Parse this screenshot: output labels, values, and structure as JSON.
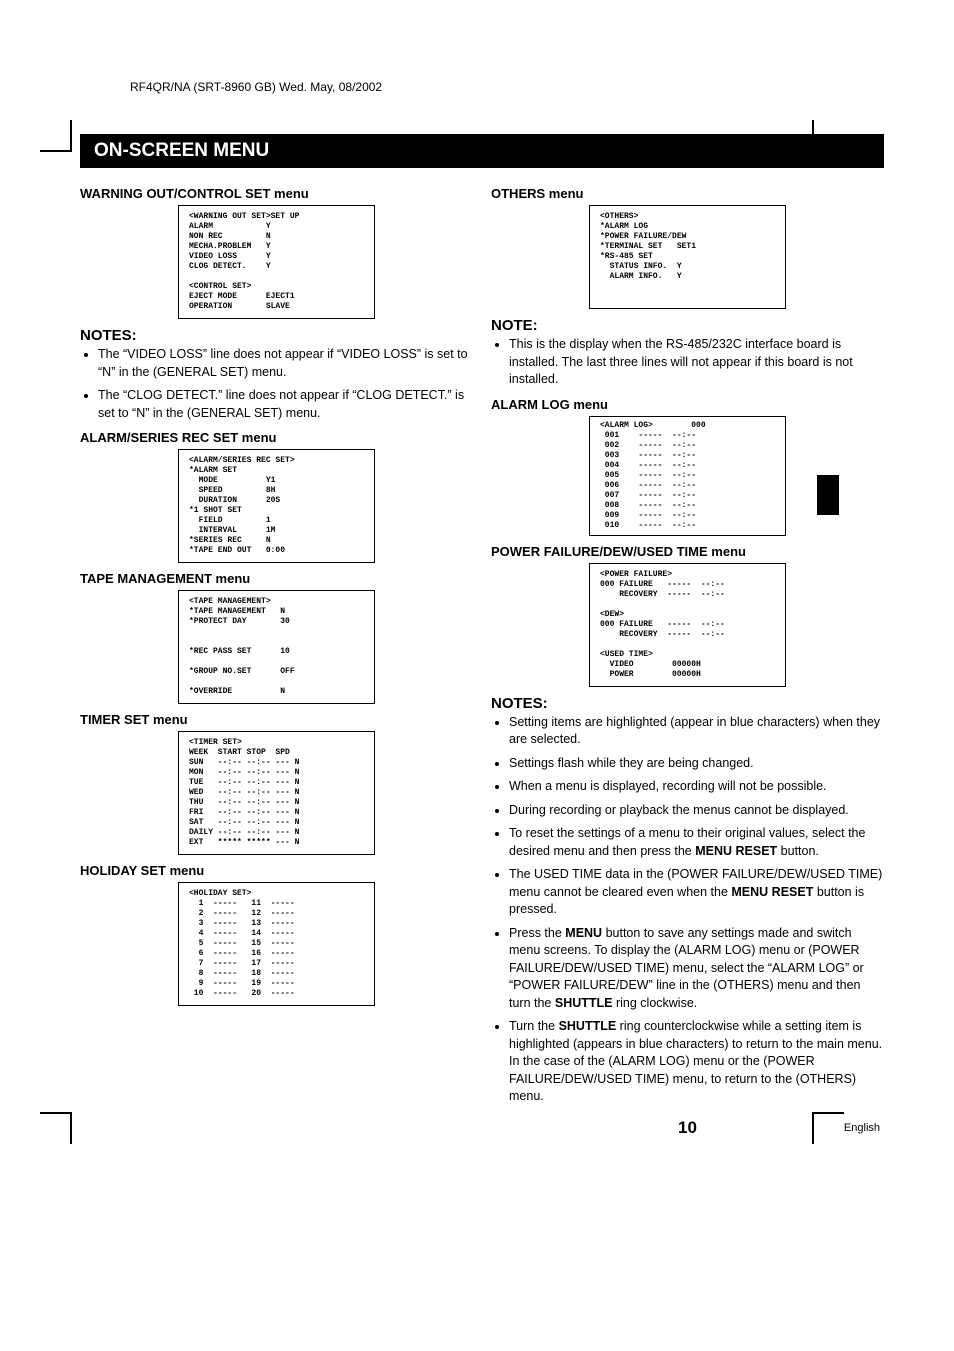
{
  "header": "RF4QR/NA (SRT-8960 GB)    Wed. May, 08/2002",
  "banner": "ON-SCREEN MENU",
  "left": {
    "warning_title": "WARNING OUT/CONTROL SET menu",
    "warning_osd": "<WARNING OUT SET>SET UP\nALARM           Y\nNON REC         N\nMECHA.PROBLEM   Y\nVIDEO LOSS      Y\nCLOG DETECT.    Y\n\n<CONTROL SET>\nEJECT MODE      EJECT1\nOPERATION       SLAVE",
    "notes1_heading": "NOTES:",
    "notes1": [
      "The “VIDEO LOSS” line does not appear if “VIDEO LOSS” is set to “N” in the (GENERAL SET) menu.",
      "The “CLOG DETECT.” line does not appear if “CLOG DETECT.” is set to “N” in the (GENERAL SET) menu."
    ],
    "alarm_series_title": "ALARM/SERIES REC SET menu",
    "alarm_series_osd": "<ALARM/SERIES REC SET>\n*ALARM SET\n  MODE          Y1\n  SPEED         8H\n  DURATION      20S\n*1 SHOT SET\n  FIELD         1\n  INTERVAL      1M\n*SERIES REC     N\n*TAPE END OUT   0:00",
    "tape_title": "TAPE MANAGEMENT menu",
    "tape_osd": "<TAPE MANAGEMENT>\n*TAPE MANAGEMENT   N\n*PROTECT DAY       30\n\n\n*REC PASS SET      10\n\n*GROUP NO.SET      OFF\n\n*OVERRIDE          N",
    "timer_title": "TIMER SET menu",
    "timer_osd": "<TIMER SET>\nWEEK  START STOP  SPD\nSUN   --:-- --:-- --- N\nMON   --:-- --:-- --- N\nTUE   --:-- --:-- --- N\nWED   --:-- --:-- --- N\nTHU   --:-- --:-- --- N\nFRI   --:-- --:-- --- N\nSAT   --:-- --:-- --- N\nDAILY --:-- --:-- --- N\nEXT   ***** ***** --- N",
    "holiday_title": "HOLIDAY SET menu",
    "holiday_osd": "<HOLIDAY SET>\n  1  -----   11  -----\n  2  -----   12  -----\n  3  -----   13  -----\n  4  -----   14  -----\n  5  -----   15  -----\n  6  -----   16  -----\n  7  -----   17  -----\n  8  -----   18  -----\n  9  -----   19  -----\n 10  -----   20  -----"
  },
  "right": {
    "others_title": "OTHERS menu",
    "others_osd": "<OTHERS>\n*ALARM LOG\n*POWER FAILURE/DEW\n*TERMINAL SET   SET1\n*RS-485 SET\n  STATUS INFO.  Y\n  ALARM INFO.   Y\n\n\n",
    "note_heading": "NOTE:",
    "note_items": [
      "This is the display when the RS-485/232C interface board is installed. The last three lines will not appear if this board is not installed."
    ],
    "alarm_log_title": "ALARM LOG menu",
    "alarm_log_osd": "<ALARM LOG>        000\n 001    -----  --:--\n 002    -----  --:--\n 003    -----  --:--\n 004    -----  --:--\n 005    -----  --:--\n 006    -----  --:--\n 007    -----  --:--\n 008    -----  --:--\n 009    -----  --:--\n 010    -----  --:--",
    "power_title": "POWER FAILURE/DEW/USED TIME menu",
    "power_osd": "<POWER FAILURE>\n000 FAILURE   -----  --:--\n    RECOVERY  -----  --:--\n\n<DEW>\n000 FAILURE   -----  --:--\n    RECOVERY  -----  --:--\n\n<USED TIME>\n  VIDEO        00000H\n  POWER        00000H",
    "notes2_heading": "NOTES:",
    "notes2_plain": [
      "Setting items are highlighted (appear in blue characters) when they are selected.",
      "Settings flash while they are being changed.",
      "When a menu is displayed, recording will not be possible.",
      "During recording or playback the menus cannot be displayed."
    ]
  },
  "page_number": "10",
  "language": "English"
}
